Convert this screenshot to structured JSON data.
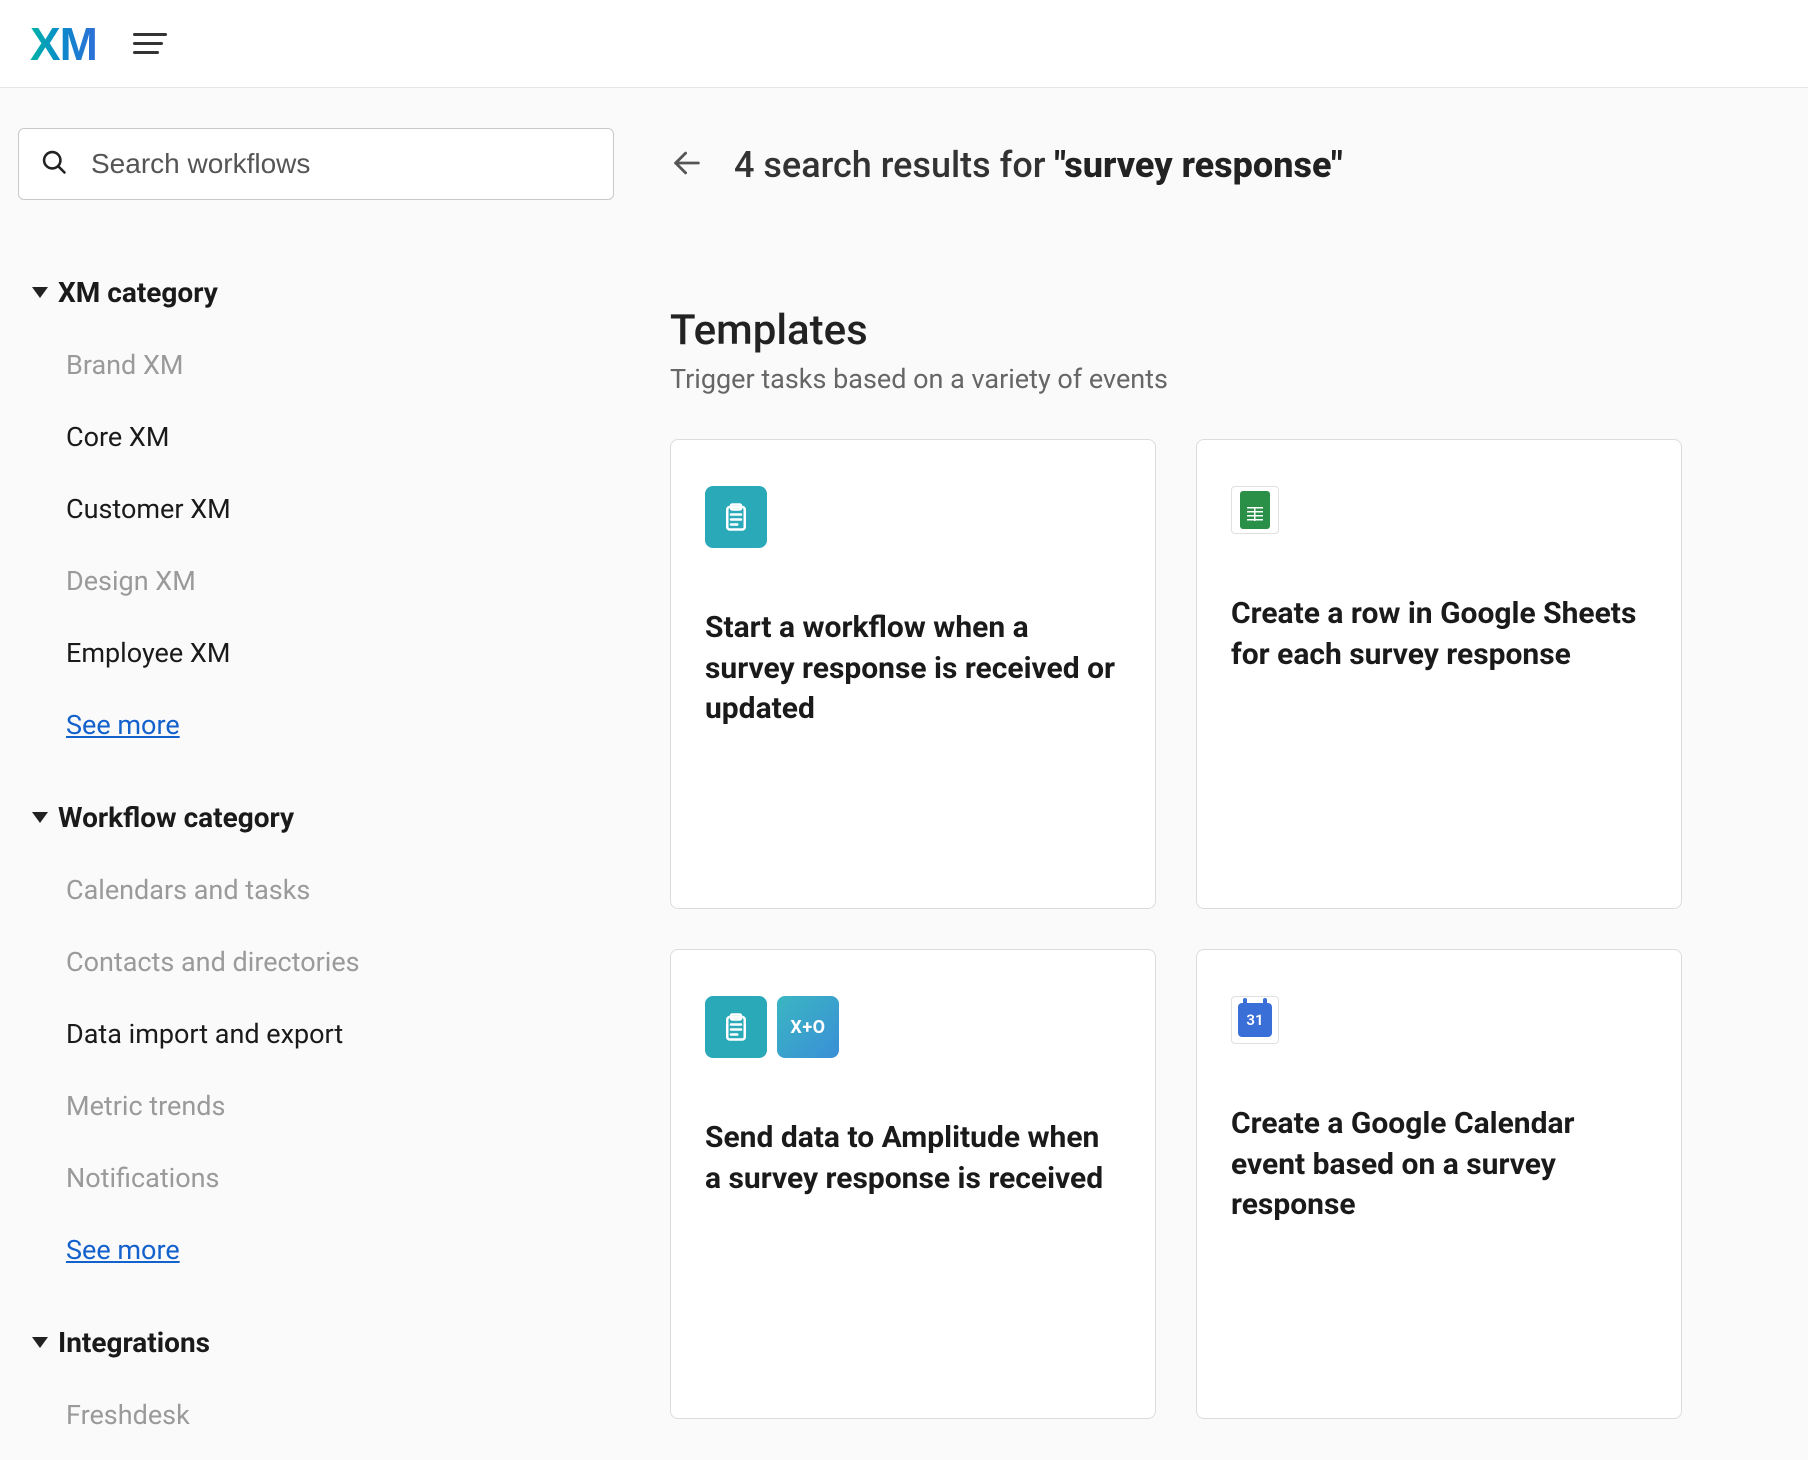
{
  "header": {
    "logo_text": "XM"
  },
  "search": {
    "placeholder": "Search workflows",
    "value": ""
  },
  "results": {
    "count_prefix": "4 search results for ",
    "query_display": "\"survey response\""
  },
  "sidebar": {
    "groups": [
      {
        "label": "XM category",
        "items": [
          {
            "label": "Brand XM",
            "muted": true
          },
          {
            "label": "Core XM",
            "muted": false
          },
          {
            "label": "Customer XM",
            "muted": false
          },
          {
            "label": "Design XM",
            "muted": true
          },
          {
            "label": "Employee XM",
            "muted": false
          }
        ],
        "see_more": "See more"
      },
      {
        "label": "Workflow category",
        "items": [
          {
            "label": "Calendars and tasks",
            "muted": true
          },
          {
            "label": "Contacts and directories",
            "muted": true
          },
          {
            "label": "Data import and export",
            "muted": false
          },
          {
            "label": "Metric trends",
            "muted": true
          },
          {
            "label": "Notifications",
            "muted": true
          }
        ],
        "see_more": "See more"
      },
      {
        "label": "Integrations",
        "items": [
          {
            "label": "Freshdesk",
            "muted": true
          }
        ]
      }
    ]
  },
  "templates": {
    "heading": "Templates",
    "subheading": "Trigger tasks based on a variety of events",
    "cards": [
      {
        "title": "Start a workflow when a survey response is received or updated"
      },
      {
        "title": "Create a row in Google Sheets for each survey response"
      },
      {
        "title": "Send data to Amplitude when a survey response is received"
      },
      {
        "title": "Create a Google Calendar event based on a survey response"
      }
    ]
  },
  "icons": {
    "amplitude_label": "X+O",
    "gcal_day": "31"
  }
}
